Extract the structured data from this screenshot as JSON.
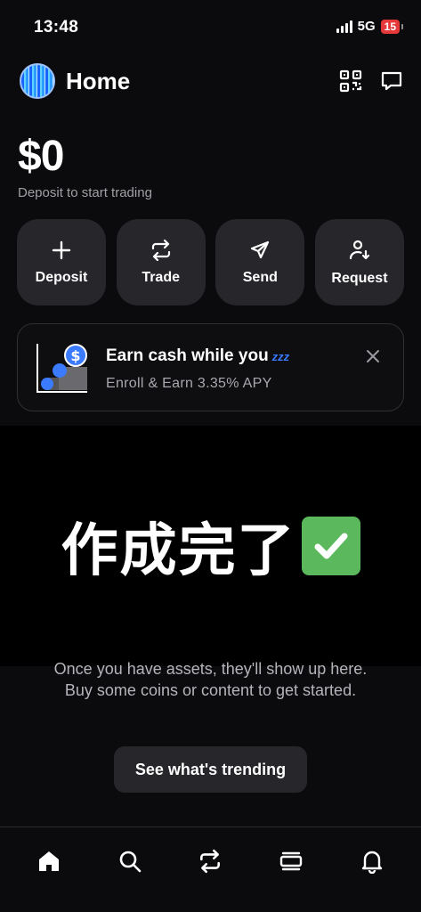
{
  "status": {
    "time": "13:48",
    "network": "5G",
    "battery": "15"
  },
  "header": {
    "title": "Home",
    "qr_icon": "qr-code-icon",
    "chat_icon": "chat-bubble-icon"
  },
  "balance": {
    "amount": "$0",
    "subtitle": "Deposit to start trading"
  },
  "actions": [
    {
      "label": "Deposit",
      "icon": "plus-icon"
    },
    {
      "label": "Trade",
      "icon": "swap-icon"
    },
    {
      "label": "Send",
      "icon": "send-icon"
    },
    {
      "label": "Request",
      "icon": "request-icon"
    }
  ],
  "promo": {
    "title": "Earn cash while you",
    "zzz": "zzz",
    "subtitle": "Enroll & Earn 3.35% APY",
    "accent": "#3b7bff"
  },
  "overlay": {
    "text": "作成完了",
    "check_color": "#5cb85c"
  },
  "empty_state": {
    "text": "Once you have assets, they'll show up here. Buy some coins or content to get started.",
    "button": "See what's trending"
  },
  "bottom_nav": [
    {
      "name": "home",
      "icon": "home-icon",
      "active": true
    },
    {
      "name": "search",
      "icon": "search-icon",
      "active": false
    },
    {
      "name": "trade",
      "icon": "swap-icon",
      "active": false
    },
    {
      "name": "portfolio",
      "icon": "stack-icon",
      "active": false
    },
    {
      "name": "notifications",
      "icon": "bell-icon",
      "active": false
    }
  ]
}
